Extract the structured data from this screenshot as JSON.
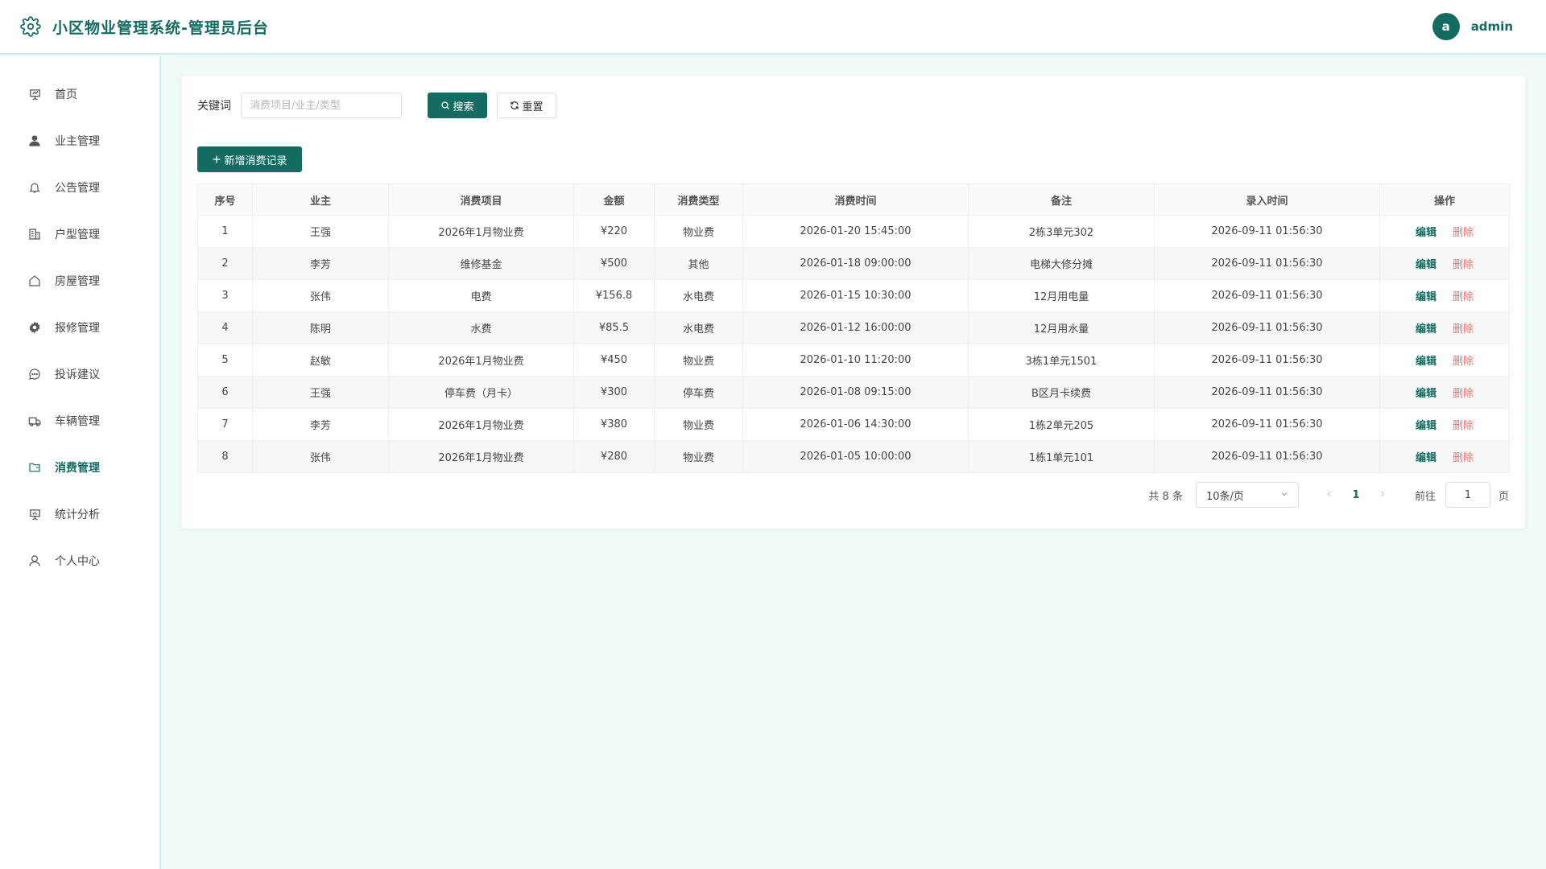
{
  "header": {
    "title": "小区物业管理系统-管理员后台",
    "avatar_letter": "a",
    "username": "admin"
  },
  "sidebar": {
    "items": [
      {
        "label": "首页",
        "icon": "presentation-icon"
      },
      {
        "label": "业主管理",
        "icon": "user-filled-icon"
      },
      {
        "label": "公告管理",
        "icon": "bell-icon"
      },
      {
        "label": "户型管理",
        "icon": "office-building-icon"
      },
      {
        "label": "房屋管理",
        "icon": "house-icon"
      },
      {
        "label": "报修管理",
        "icon": "setting-gear-icon"
      },
      {
        "label": "投诉建议",
        "icon": "chat-dot-icon"
      },
      {
        "label": "车辆管理",
        "icon": "van-icon"
      },
      {
        "label": "消费管理",
        "icon": "folder-icon",
        "active": true
      },
      {
        "label": "统计分析",
        "icon": "data-board-icon"
      },
      {
        "label": "个人中心",
        "icon": "user-icon"
      }
    ]
  },
  "search": {
    "keyword_label": "关键词",
    "placeholder": "消费项目/业主/类型",
    "value": "",
    "search_label": "搜索",
    "reset_label": "重置"
  },
  "add_button_label": "新增消费记录",
  "table": {
    "columns": [
      "序号",
      "业主",
      "消费项目",
      "金额",
      "消费类型",
      "消费时间",
      "备注",
      "录入时间",
      "操作"
    ],
    "edit_label": "编辑",
    "delete_label": "删除",
    "rows": [
      {
        "no": "1",
        "owner": "王强",
        "item": "2026年1月物业费",
        "amount": "¥220",
        "type": "物业费",
        "time": "2026-01-20 15:45:00",
        "remark": "2栋3单元302",
        "created": "2026-09-11 01:56:30"
      },
      {
        "no": "2",
        "owner": "李芳",
        "item": "维修基金",
        "amount": "¥500",
        "type": "其他",
        "time": "2026-01-18 09:00:00",
        "remark": "电梯大修分摊",
        "created": "2026-09-11 01:56:30"
      },
      {
        "no": "3",
        "owner": "张伟",
        "item": "电费",
        "amount": "¥156.8",
        "type": "水电费",
        "time": "2026-01-15 10:30:00",
        "remark": "12月用电量",
        "created": "2026-09-11 01:56:30"
      },
      {
        "no": "4",
        "owner": "陈明",
        "item": "水费",
        "amount": "¥85.5",
        "type": "水电费",
        "time": "2026-01-12 16:00:00",
        "remark": "12月用水量",
        "created": "2026-09-11 01:56:30"
      },
      {
        "no": "5",
        "owner": "赵敏",
        "item": "2026年1月物业费",
        "amount": "¥450",
        "type": "物业费",
        "time": "2026-01-10 11:20:00",
        "remark": "3栋1单元1501",
        "created": "2026-09-11 01:56:30"
      },
      {
        "no": "6",
        "owner": "王强",
        "item": "停车费（月卡）",
        "amount": "¥300",
        "type": "停车费",
        "time": "2026-01-08 09:15:00",
        "remark": "B区月卡续费",
        "created": "2026-09-11 01:56:30"
      },
      {
        "no": "7",
        "owner": "李芳",
        "item": "2026年1月物业费",
        "amount": "¥380",
        "type": "物业费",
        "time": "2026-01-06 14:30:00",
        "remark": "1栋2单元205",
        "created": "2026-09-11 01:56:30"
      },
      {
        "no": "8",
        "owner": "张伟",
        "item": "2026年1月物业费",
        "amount": "¥280",
        "type": "物业费",
        "time": "2026-01-05 10:00:00",
        "remark": "1栋1单元101",
        "created": "2026-09-11 01:56:30"
      }
    ]
  },
  "pagination": {
    "total_text": "共 8 条",
    "page_size": "10条/页",
    "current_page": "1",
    "goto_label": "前往",
    "goto_value": "1",
    "page_unit": "页"
  },
  "colors": {
    "accent": "#136b62",
    "danger": "#f56c6c",
    "background": "#f0fbf9"
  }
}
